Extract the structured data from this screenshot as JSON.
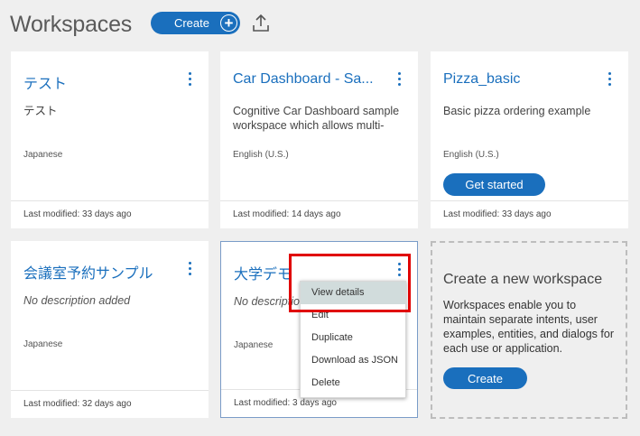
{
  "header": {
    "title": "Workspaces",
    "create_label": "Create",
    "upload_icon": "upload-icon"
  },
  "workspaces": [
    {
      "title": "テスト",
      "description": "テスト",
      "language": "Japanese",
      "modified": "Last modified: 33 days ago"
    },
    {
      "title": "Car Dashboard - Sa...",
      "description": "Cognitive Car Dashboard sample workspace which allows multi-",
      "language": "English (U.S.)",
      "modified": "Last modified: 14 days ago"
    },
    {
      "title": "Pizza_basic",
      "description": "Basic pizza ordering example",
      "language": "English (U.S.)",
      "modified": "Last modified: 33 days ago",
      "action": "Get started"
    },
    {
      "title": "会議室予約サンプル",
      "description": "No description added",
      "language": "Japanese",
      "modified": "Last modified: 32 days ago"
    },
    {
      "title": "大学デモ",
      "description": "No descriptio",
      "language": "Japanese",
      "modified": "Last modified: 3 days ago"
    }
  ],
  "new_workspace": {
    "title": "Create a new workspace",
    "description": "Workspaces enable you to maintain separate intents, user examples, entities, and dialogs for each use or application.",
    "create_label": "Create"
  },
  "context_menu": {
    "items": [
      "View details",
      "Edit",
      "Duplicate",
      "Download as JSON",
      "Delete"
    ],
    "active": "View details"
  },
  "colors": {
    "accent": "#1a6fbd",
    "highlight": "#e00000",
    "background": "#efefef"
  }
}
